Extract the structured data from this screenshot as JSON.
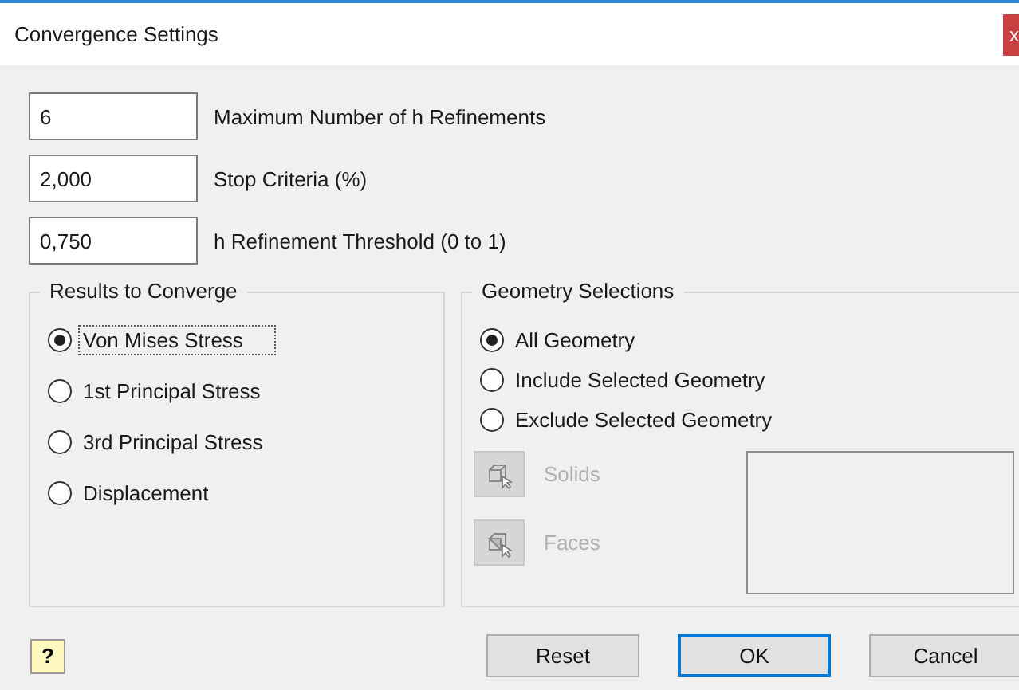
{
  "window": {
    "title": "Convergence Settings",
    "close": "x"
  },
  "fields": [
    {
      "value": "6",
      "label": "Maximum Number of h Refinements"
    },
    {
      "value": "2,000",
      "label": "Stop Criteria (%)"
    },
    {
      "value": "0,750",
      "label": "h Refinement Threshold (0 to 1)"
    }
  ],
  "results_group": {
    "title": "Results to Converge",
    "options": [
      {
        "label": "Von Mises Stress",
        "selected": true
      },
      {
        "label": "1st Principal Stress",
        "selected": false
      },
      {
        "label": "3rd Principal Stress",
        "selected": false
      },
      {
        "label": "Displacement",
        "selected": false
      }
    ]
  },
  "geometry_group": {
    "title": "Geometry Selections",
    "options": [
      {
        "label": "All Geometry",
        "selected": true
      },
      {
        "label": "Include Selected Geometry",
        "selected": false
      },
      {
        "label": "Exclude Selected Geometry",
        "selected": false
      }
    ],
    "pickers": [
      {
        "kind": "solids",
        "label": "Solids",
        "disabled": true
      },
      {
        "kind": "faces",
        "label": "Faces",
        "disabled": true
      }
    ]
  },
  "help_button": {
    "label": "?"
  },
  "buttons": [
    {
      "label": "Reset",
      "default": false
    },
    {
      "label": "OK",
      "default": true
    },
    {
      "label": "Cancel",
      "default": false
    }
  ]
}
